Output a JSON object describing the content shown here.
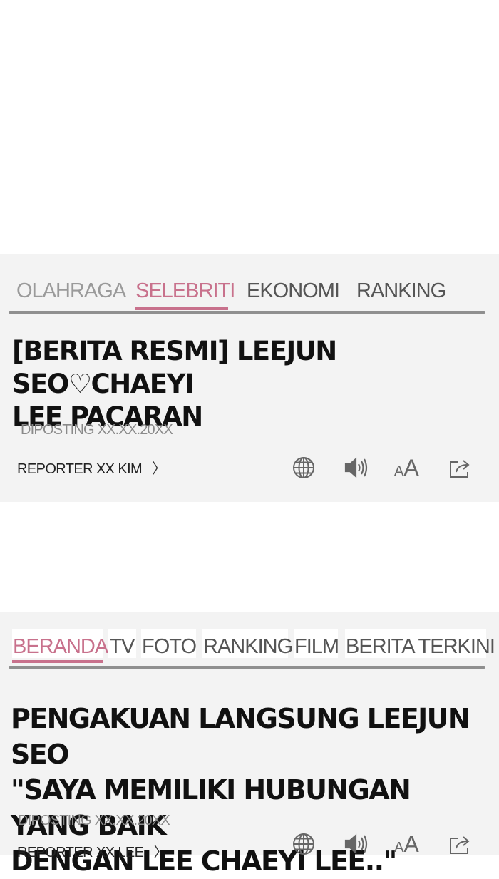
{
  "article1": {
    "tabs": [
      {
        "label": "OLAHRAGA",
        "state": "inactive"
      },
      {
        "label": "SELEBRITI",
        "state": "active"
      },
      {
        "label": "EKONOMI",
        "state": "inactive"
      },
      {
        "label": "RANKING",
        "state": "inactive"
      }
    ],
    "headline_line1": "[BERITA RESMI] LEEJUN SEO♡CHAEYI",
    "headline_line2": "LEE PACARAN",
    "posted": "DIPOSTING XX.XX.20XX",
    "reporter": "REPORTER XX KIM",
    "reporter_chevron": "〉"
  },
  "article2": {
    "tabs": [
      {
        "label": "BERANDA",
        "state": "active"
      },
      {
        "label": "TV",
        "state": "inactive"
      },
      {
        "label": "FOTO",
        "state": "inactive"
      },
      {
        "label": "RANKING",
        "state": "inactive"
      },
      {
        "label": "FILM",
        "state": "inactive"
      },
      {
        "label": "BERITA TERKINI",
        "state": "inactive"
      }
    ],
    "headline_line1": "PENGAKUAN LANGSUNG LEEJUN SEO",
    "headline_line2": "\"SAYA MEMILIKI HUBUNGAN YANG BAIK",
    "headline_line3": "DENGAN LEE CHAEYI LEE..\"",
    "posted": "DIPOSTING XX.XX.20XX",
    "reporter": "REPORTER XX LEE",
    "reporter_chevron": "〉"
  },
  "toolbar": {
    "icons": [
      "globe-icon",
      "speaker-icon",
      "font-size-icon",
      "share-icon"
    ],
    "font_small": "A",
    "font_big": "A"
  },
  "colors": {
    "accent": "#c8718c",
    "panel_bg": "#f3f3f3",
    "rule": "#8f8f8f",
    "inactive_tab": "#555555",
    "muted_tab": "#9a9a9a"
  }
}
